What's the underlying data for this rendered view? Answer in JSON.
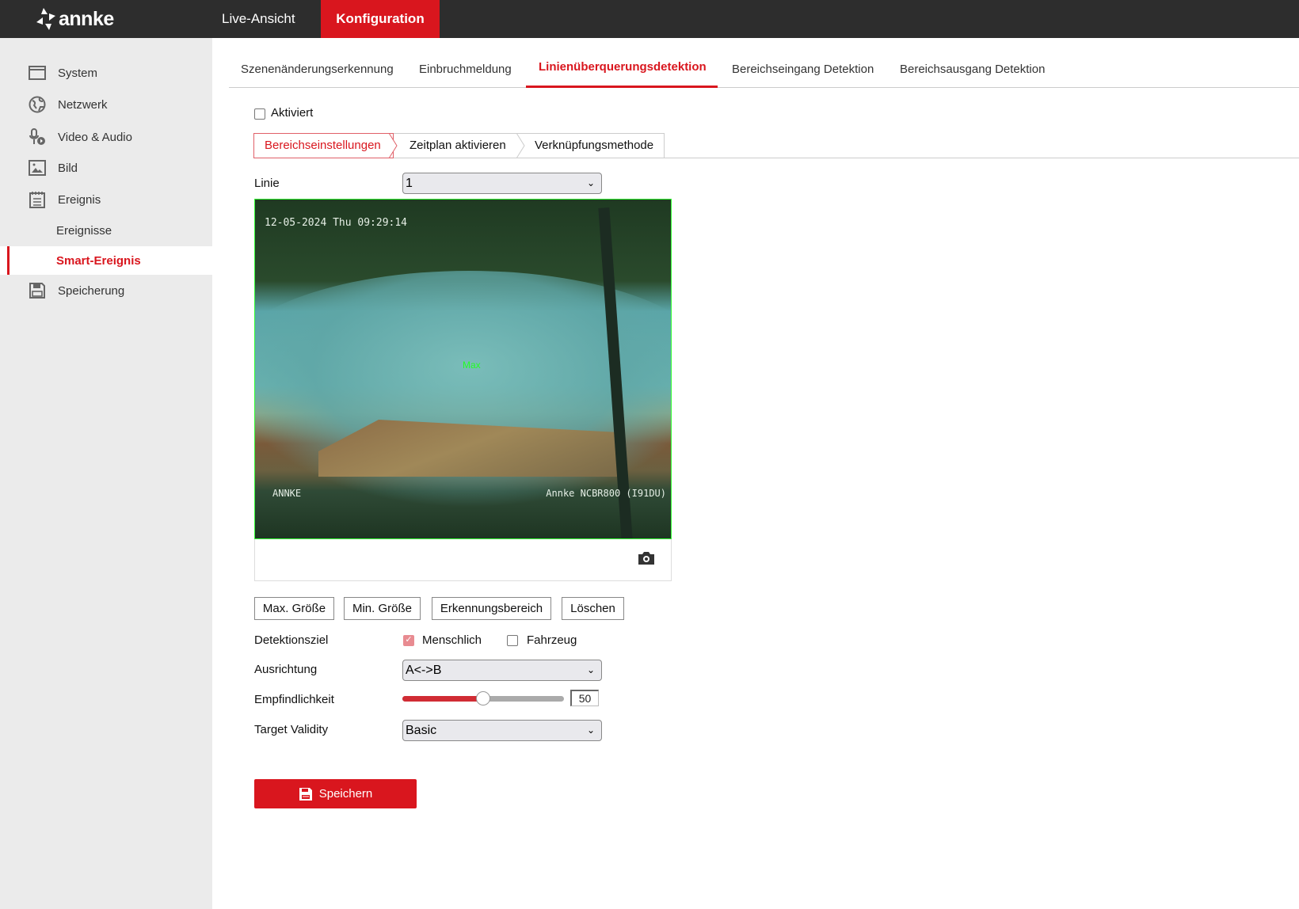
{
  "header": {
    "logo": "annke",
    "nav": [
      {
        "label": "Live-Ansicht"
      },
      {
        "label": "Konfiguration",
        "active": true
      }
    ]
  },
  "sidebar": {
    "items": [
      {
        "label": "System",
        "icon": "window-icon"
      },
      {
        "label": "Netzwerk",
        "icon": "globe-icon"
      },
      {
        "label": "Video & Audio",
        "icon": "microphone-icon"
      },
      {
        "label": "Bild",
        "icon": "image-icon"
      },
      {
        "label": "Ereignis",
        "icon": "calendar-icon"
      },
      {
        "label": "Ereignisse"
      },
      {
        "label": "Smart-Ereignis",
        "active": true
      },
      {
        "label": "Speicherung",
        "icon": "floppy-icon"
      }
    ]
  },
  "tabs": [
    {
      "label": "Szenenänderungserkennung"
    },
    {
      "label": "Einbruchmeldung"
    },
    {
      "label": "Linienüberquerungsdetektion",
      "active": true
    },
    {
      "label": "Bereichseingang Detektion"
    },
    {
      "label": "Bereichsausgang Detektion"
    }
  ],
  "enabled": {
    "label": "Aktiviert",
    "checked": false
  },
  "subtabs": [
    {
      "label": "Bereichseinstellungen",
      "active": true
    },
    {
      "label": "Zeitplan aktivieren"
    },
    {
      "label": "Verknüpfungsmethode"
    }
  ],
  "line": {
    "label": "Linie",
    "value": "1"
  },
  "video": {
    "timestamp": "12-05-2024 Thu 09:29:14",
    "osd_left": "ANNKE",
    "osd_right": "Annke NCBR800 (I91DU)",
    "overlay_label": "Max"
  },
  "buttons": {
    "max": "Max. Größe",
    "min": "Min. Größe",
    "area": "Erkennungsbereich",
    "clear": "Löschen"
  },
  "target": {
    "label": "Detektionsziel",
    "human": {
      "label": "Menschlich",
      "checked": true
    },
    "vehicle": {
      "label": "Fahrzeug",
      "checked": false
    }
  },
  "direction": {
    "label": "Ausrichtung",
    "value": "A<->B"
  },
  "sensitivity": {
    "label": "Empfindlichkeit",
    "value": "50",
    "percent": 50
  },
  "validity": {
    "label": "Target Validity",
    "value": "Basic"
  },
  "save": "Speichern",
  "colors": {
    "accent": "#d9161e",
    "header": "#2d2d2d",
    "sidebar": "#ebebeb"
  }
}
